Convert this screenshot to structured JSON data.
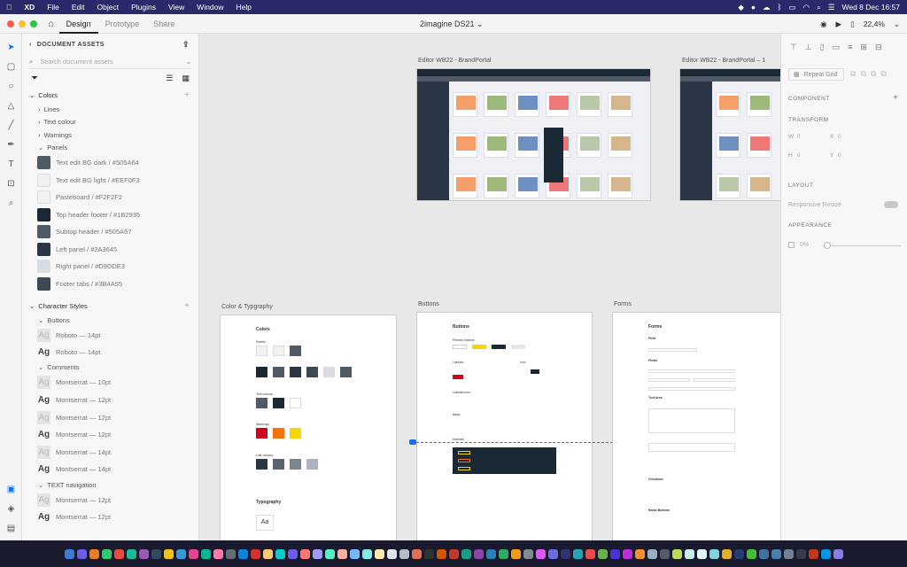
{
  "menubar": {
    "apple": "",
    "items": [
      "XD",
      "File",
      "Edit",
      "Object",
      "Plugins",
      "View",
      "Window",
      "Help"
    ],
    "datetime": "Wed 8 Dec 16:57"
  },
  "titlebar": {
    "tabs": [
      "Design",
      "Prototype",
      "Share"
    ],
    "doc_title": "2imagine DS21 ⌄",
    "zoom": "22,4%"
  },
  "assets": {
    "header": "DOCUMENT ASSETS",
    "search_placeholder": "Search document assets",
    "colors_title": "Colors",
    "color_groups": [
      "Lines",
      "Text colour",
      "Warnings",
      "Panels"
    ],
    "swatches": [
      {
        "name": "Text edit BG dark / #505A64",
        "color": "#505A64"
      },
      {
        "name": "Text edit BG light / #EEF0F3",
        "color": "#EEF0F3"
      },
      {
        "name": "Pasteboard / #F2F2F2",
        "color": "#F2F2F2"
      },
      {
        "name": "Top header footer / #1B2935",
        "color": "#1B2935"
      },
      {
        "name": "Subtop header / #505A67",
        "color": "#505A67"
      },
      {
        "name": "Left panel / #2A3645",
        "color": "#2A3645"
      },
      {
        "name": "Right panel / #D9DDE3",
        "color": "#D9DDE3"
      },
      {
        "name": "Footer tabs / #3B4A55",
        "color": "#3B4A55"
      }
    ],
    "char_styles_title": "Character Styles",
    "char_groups": [
      {
        "label": "Buttons",
        "items": [
          {
            "ag": "Ag",
            "name": "Roboto — 14pt",
            "light": true
          },
          {
            "ag": "Ag",
            "name": "Roboto — 14pt",
            "light": false
          }
        ]
      },
      {
        "label": "Comments",
        "items": [
          {
            "ag": "Ag",
            "name": "Montserrat — 10pt",
            "light": true
          },
          {
            "ag": "Ag",
            "name": "Montserrat — 12pt",
            "light": false
          },
          {
            "ag": "Ag",
            "name": "Montserrat — 12pt",
            "light": true
          },
          {
            "ag": "Ag",
            "name": "Montserrat — 12pt",
            "light": false
          },
          {
            "ag": "Ag",
            "name": "Montserrat — 14pt",
            "light": true
          },
          {
            "ag": "Ag",
            "name": "Montserrat — 14pt",
            "light": false
          }
        ]
      },
      {
        "label": "TEXT navigation",
        "items": [
          {
            "ag": "Ag",
            "name": "Montserrat — 12pt",
            "light": true
          },
          {
            "ag": "Ag",
            "name": "Montserrat — 12pt",
            "light": false
          }
        ]
      }
    ]
  },
  "canvas": {
    "artboards": [
      {
        "label": "Editor WB22 - BrandPortal"
      },
      {
        "label": "Editor WB22 - BrandPortal – 1"
      },
      {
        "label": "Color & Typgraphy"
      },
      {
        "label": "Buttons"
      },
      {
        "label": "Forms"
      }
    ],
    "color_typo": {
      "title": "Colors",
      "panels": "Panels",
      "text_colours": "Text colours",
      "warnings": "Warnings",
      "line_colours": "Line colours",
      "typography": "Typography",
      "aa": "Aa"
    },
    "buttons_ab": {
      "title": "Buttons",
      "primary": "Primary buttons",
      "labeled": "Labeled",
      "icon": "Icon",
      "labeled_icon": "Labeled Icon",
      "basic": "Basic",
      "inverted": "Inverted"
    },
    "forms_ab": {
      "title": "Forms",
      "field": "Field",
      "fields": "Fields",
      "text_area": "Text Area",
      "checkbox": "Checkbox",
      "radio": "Radio Buttons"
    }
  },
  "props": {
    "repeat_grid": "Repeat Grid",
    "component": "COMPONENT",
    "transform": "TRANSFORM",
    "w": "W",
    "w_val": "0",
    "x": "X",
    "x_val": "0",
    "h": "H",
    "h_val": "0",
    "y": "Y",
    "y_val": "0",
    "layout": "LAYOUT",
    "responsive": "Responsive Resize",
    "appearance": "APPEARANCE",
    "opacity": "0%"
  },
  "colors": {
    "menubar": "#2a2a6a",
    "accent": "#1473e6",
    "red": "#d0021b",
    "orange": "#f5720a",
    "yellow": "#f8d700"
  }
}
